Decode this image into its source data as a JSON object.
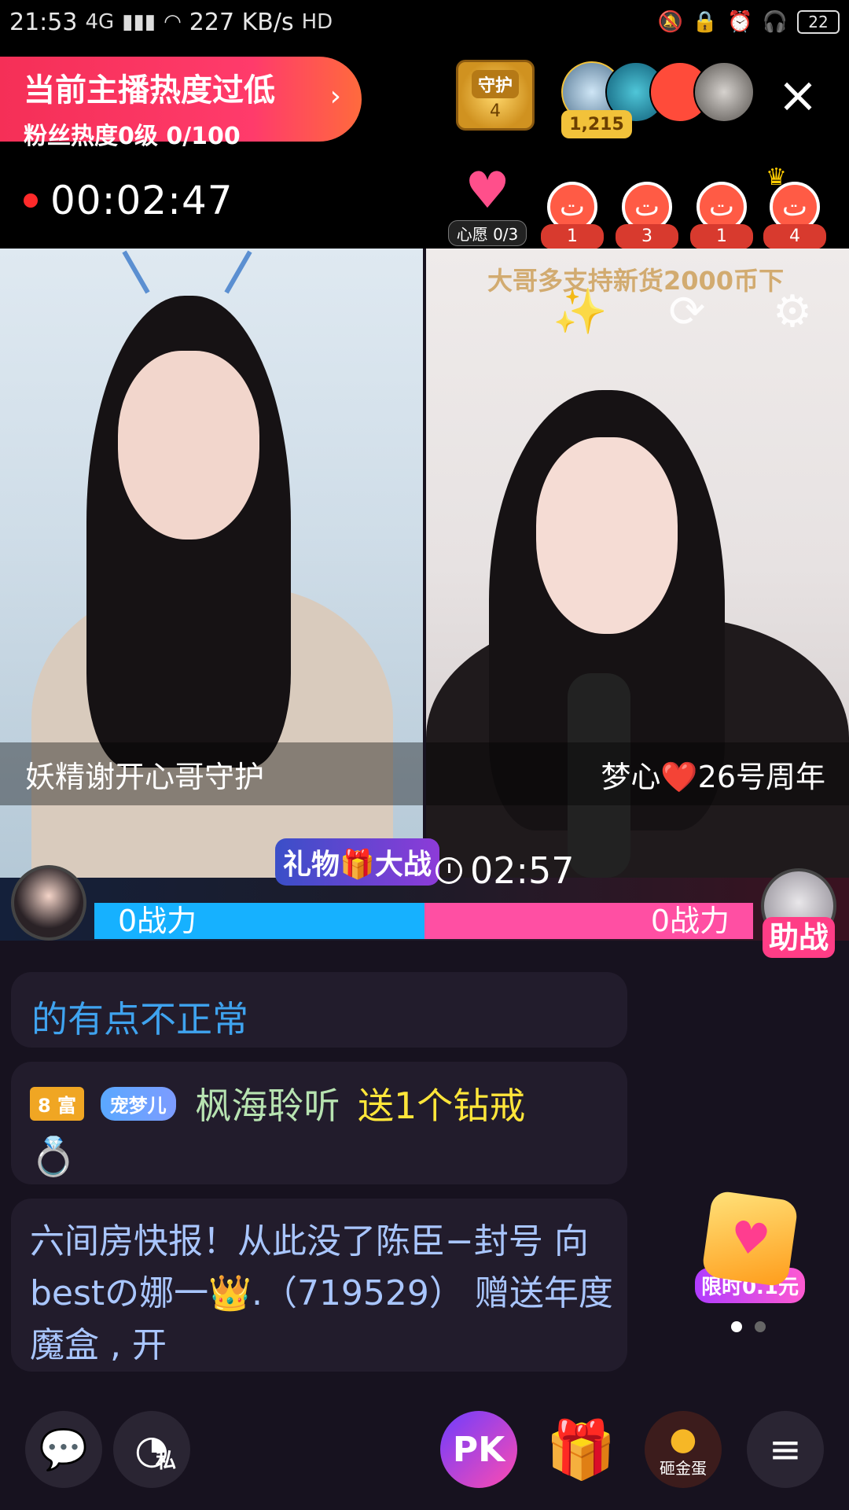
{
  "status_bar": {
    "time": "21:53",
    "network": "4G",
    "speed": "227 KB/s",
    "hd": "HD",
    "battery": "22"
  },
  "header": {
    "heat_title": "当前主播热度过低",
    "heat_sub": "粉丝热度0级 0/100",
    "guard_label": "守护",
    "guard_count": "4",
    "viewer_count": "1,215",
    "timer": "00:02:47",
    "wish_label": "心愿 0/3",
    "fans": [
      {
        "count": "1"
      },
      {
        "count": "3"
      },
      {
        "count": "1"
      },
      {
        "count": "4"
      }
    ]
  },
  "panes": {
    "left_name": "妖精谢开心哥守护",
    "right_name": "梦心❤️26号周年",
    "right_overlay": "大哥多支持新货2000币下"
  },
  "battle": {
    "label": "礼物🎁大战",
    "timer": "02:57",
    "left_power": "0战力",
    "right_power": "0战力",
    "assist": "助战"
  },
  "chat": {
    "msg1": "的有点不正常",
    "msg2": {
      "rich_badge": "8 富",
      "fan_badge": "宠梦儿",
      "sender": "枫海聆听",
      "gift": "送1个钻戒"
    },
    "msg3": "六间房快报！从此没了陈臣−封号 向 bestの娜一👑.（719529） 赠送年度魔盒 , 开"
  },
  "promo": {
    "tag": "限时0.1元"
  },
  "toolbar": {
    "private_mark": "私",
    "pk_label": "PK",
    "egg_label": "砸金蛋"
  },
  "colors": {
    "bar_left": "#16b1ff",
    "bar_right": "#ff4fa3",
    "heat_banner": "#f52f57"
  }
}
